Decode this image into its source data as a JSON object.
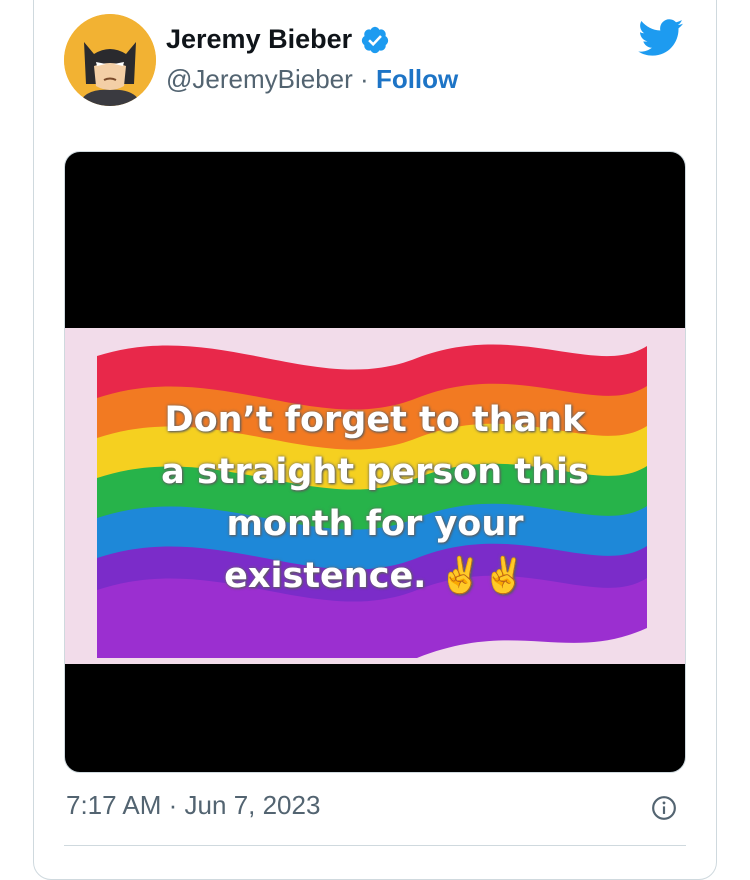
{
  "tweet": {
    "display_name": "Jeremy Bieber",
    "handle": "@JeremyBieber",
    "separator": "·",
    "follow_label": "Follow",
    "image_text_lines": [
      "Don’t forget to thank",
      "a straight person this",
      "month for your",
      "existence. ✌️✌️"
    ],
    "time": "7:17 AM",
    "date_separator": "·",
    "date": "Jun 7, 2023"
  },
  "icons": {
    "verified": "verified-badge-icon",
    "brand": "twitter-bird-icon",
    "info": "info-icon",
    "avatar": "batman-avatar"
  },
  "colors": {
    "follow": "#1d74c6",
    "verified": "#1d9bf0",
    "bird": "#1d9bf0",
    "secondary_text": "#536471"
  }
}
